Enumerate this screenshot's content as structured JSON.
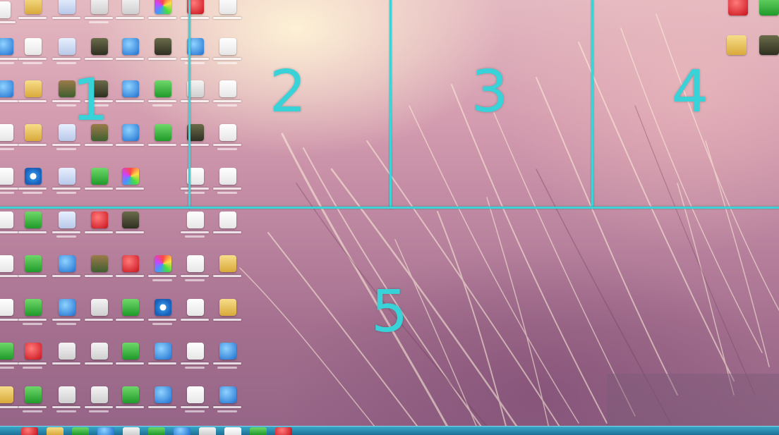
{
  "zones": {
    "z1": "1",
    "z2": "2",
    "z3": "3",
    "z4": "4",
    "z5": "5"
  },
  "colors": {
    "grid_line": "#3fd2d6",
    "zone_label": "#38d3d8",
    "taskbar": "#1c6f97"
  },
  "icons": [
    "folder-icon",
    "document-icon",
    "browser-icon",
    "app-icon",
    "music-file-icon",
    "internet-explorer-icon",
    "chrome-icon",
    "qq-penguin-icon",
    "wechat-icon",
    "netease-music-icon",
    "360-browser-icon",
    "notepad-icon",
    "image-file-icon"
  ]
}
